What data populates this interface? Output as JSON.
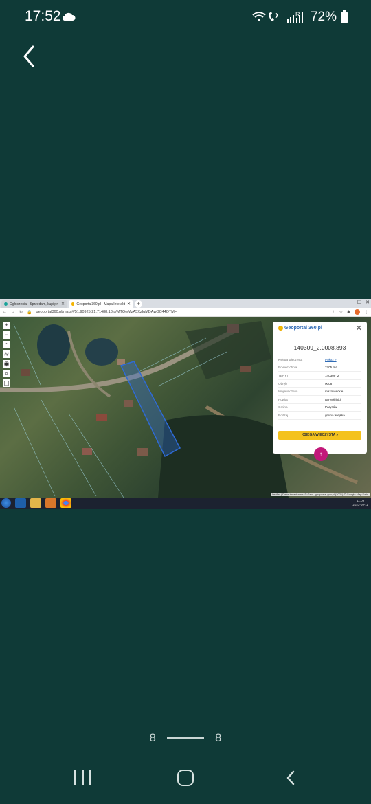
{
  "status_bar": {
    "time": "17:52",
    "battery": "72%",
    "icons": [
      "cloud-icon",
      "wifi-calling-icon",
      "signal-icon",
      "battery-icon"
    ]
  },
  "navigation": {
    "back_icon": "chevron-left-icon"
  },
  "screenshot": {
    "browser": {
      "tabs": [
        {
          "label": "Ogłoszenia - Sprzedam, kupię n"
        },
        {
          "label": "Geoportal360.pl - Mapa Interakt"
        }
      ],
      "url": "geoportal360.pl/map/#/51.90925,21.71488,18,p/MTQwMzA5XzIuMDAwOC44OTM="
    },
    "map": {
      "popup": {
        "logo_text": "Geoportal 360.pl",
        "close_icon": "close-icon",
        "title": "140309_2.0008.893",
        "rows": [
          {
            "key": "Księga wieczysta",
            "value": "Pokaż »"
          },
          {
            "key": "Powierzchnia",
            "value": "2705 m²"
          },
          {
            "key": "TERYT",
            "value": "140309_2"
          },
          {
            "key": "Obręb",
            "value": "0008"
          },
          {
            "key": "Województwo",
            "value": "mazowieckie"
          },
          {
            "key": "Powiat",
            "value": "garwoliński"
          },
          {
            "key": "Gmina",
            "value": "Parysów"
          },
          {
            "key": "Rodzaj",
            "value": "gmina wiejska"
          }
        ],
        "button_label": "KSIĘGA WIECZYSTA »"
      },
      "attribution": "Leaflet | Dane katastralne: © Geo - geoportal.gov.pl (2021) © Google Map Data",
      "controls": [
        "+",
        "−"
      ]
    },
    "taskbar": {
      "clock": "11:09",
      "date": "2023-09-11"
    }
  },
  "pager": {
    "current": "8",
    "total": "8"
  },
  "system_nav": {
    "items": [
      "recent-apps-button",
      "home-button",
      "back-button"
    ]
  },
  "colors": {
    "background": "#0f3a37",
    "popup_button": "#f4c21d",
    "pin": "#c2187a",
    "parcel_outline": "#2f6bd6"
  }
}
